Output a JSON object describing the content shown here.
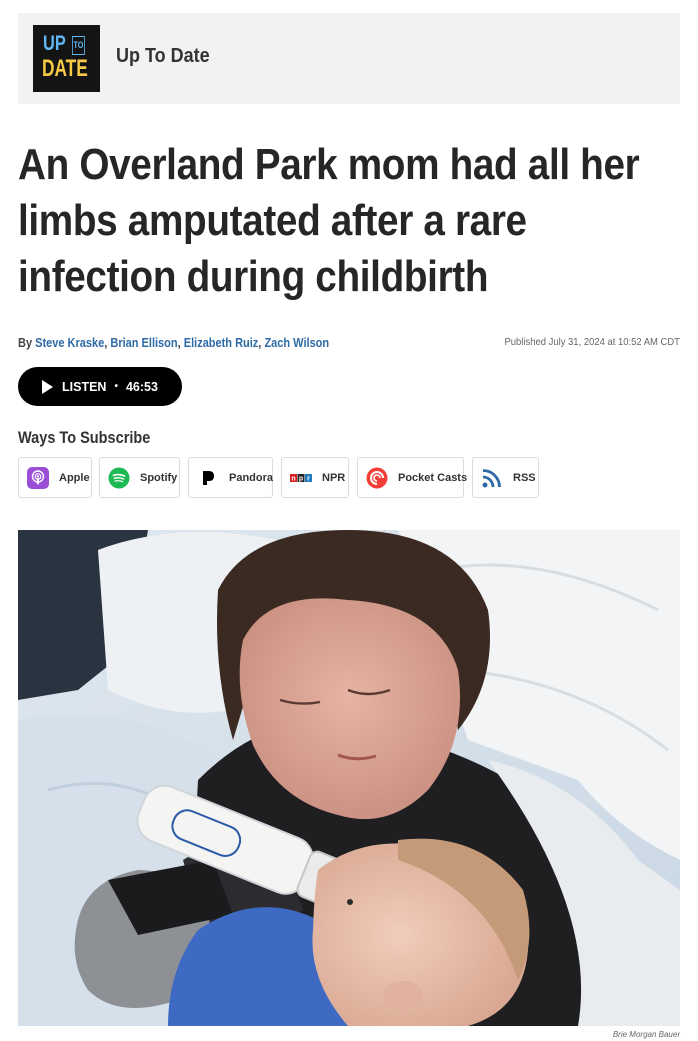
{
  "show": {
    "logo_up": "UP",
    "logo_to": "TO",
    "logo_date": "DATE",
    "name": "Up To Date"
  },
  "article": {
    "headline_lines": [
      "An Overland Park mom had all her",
      "limbs amputated after a rare",
      "infection during childbirth"
    ],
    "by_prefix": "By",
    "authors": [
      "Steve Kraske",
      "Brian Ellison",
      "Elizabeth Ruiz",
      "Zach Wilson"
    ],
    "separator": ",",
    "published": "Published July 31, 2024 at 10:52 AM CDT"
  },
  "listen": {
    "label": "LISTEN",
    "dot": "•",
    "duration": "46:53"
  },
  "subscribe": {
    "title": "Ways To Subscribe",
    "services": [
      {
        "label": "Apple",
        "icon": "apple-podcasts-icon",
        "color": "#9b4fd6"
      },
      {
        "label": "Spotify",
        "icon": "spotify-icon",
        "color": "#1db954"
      },
      {
        "label": "Pandora",
        "icon": "pandora-icon",
        "color": "#000000"
      },
      {
        "label": "NPR",
        "icon": "npr-icon",
        "npr_letters": [
          "n",
          "p",
          "r"
        ]
      },
      {
        "label": "Pocket Casts",
        "icon": "pocket-casts-icon",
        "color": "#f43e37"
      },
      {
        "label": "RSS",
        "icon": "rss-icon",
        "color": "#2e6aa6"
      }
    ]
  },
  "photo": {
    "credit": "Brie Morgan Bauer"
  },
  "colors": {
    "link": "#2e6aa6",
    "button_bg": "#000000",
    "logo_blue": "#5fb8f3",
    "logo_yellow": "#f7c945"
  }
}
